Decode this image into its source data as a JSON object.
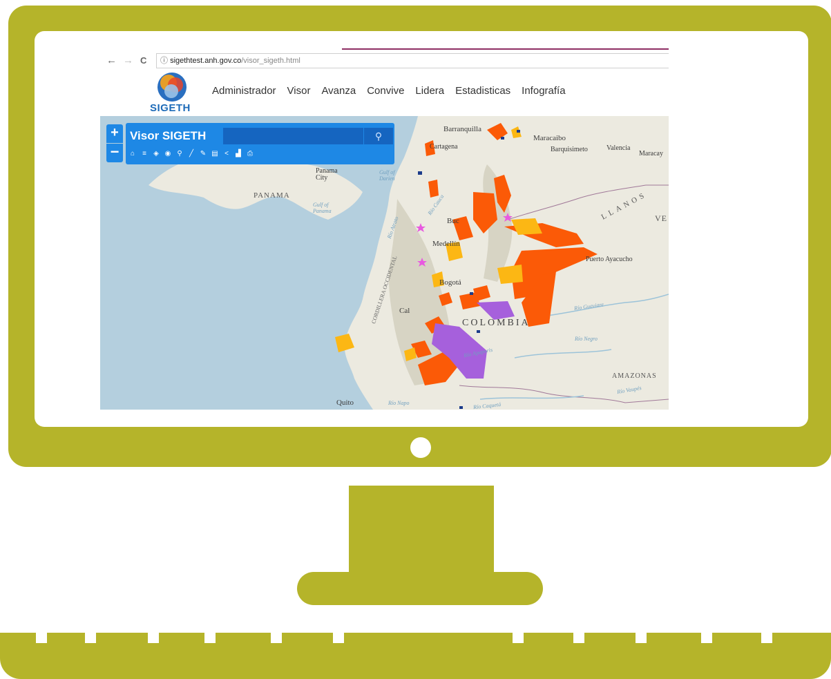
{
  "browser": {
    "back_glyph": "←",
    "forward_glyph": "→",
    "reload_glyph": "C",
    "info_glyph": "ⓘ",
    "url_host": "sigethtest.anh.gov.co",
    "url_path": "/visor_sigeth.html"
  },
  "site": {
    "logo_text": "SIGETH",
    "nav": [
      "Administrador",
      "Visor",
      "Avanza",
      "Convive",
      "Lidera",
      "Estadisticas",
      "Infografía"
    ]
  },
  "viewer": {
    "zoom_in": "+",
    "zoom_out": "−",
    "title": "Visor SIGETH",
    "search_value": "",
    "search_glyph": "⚲",
    "tools": [
      {
        "icon": "home-icon",
        "glyph": "⌂"
      },
      {
        "icon": "list-icon",
        "glyph": "≡"
      },
      {
        "icon": "layers-icon",
        "glyph": "◈"
      },
      {
        "icon": "basemap-icon",
        "glyph": "◉"
      },
      {
        "icon": "location-icon",
        "glyph": "⚲"
      },
      {
        "icon": "draw-icon",
        "glyph": "╱"
      },
      {
        "icon": "edit-icon",
        "glyph": "✎"
      },
      {
        "icon": "comment-icon",
        "glyph": "▤"
      },
      {
        "icon": "share-icon",
        "glyph": "<"
      },
      {
        "icon": "bookmark-icon",
        "glyph": "▟"
      },
      {
        "icon": "print-icon",
        "glyph": "⎙"
      }
    ]
  },
  "map": {
    "labels": {
      "barranquilla": "Barranquilla",
      "maracaibo": "Maracaibo",
      "barquisimeto": "Barquisimeto",
      "valencia": "Valencia",
      "maracay": "Maracay",
      "cartagena": "Cartagena",
      "panama_city": "Panama City",
      "gulf_darien": "Gulf of Darien",
      "panama": "PANAMA",
      "gulf_panama": "Gulf of Panama",
      "llanos": "LLANOS",
      "venezuela_partial": "VE",
      "bucaramanga_partial": "Buc",
      "medellin": "Medellín",
      "puerto_ayacucho": "Puerto Ayacucho",
      "bogota": "Bogotá",
      "cali_partial": "Cal",
      "colombia": "COLOMBIA",
      "rio_guaviare": "Río Guaviare",
      "rio_negro": "Río Negro",
      "rio_apaporis": "Río Apaporis",
      "amazonas": "AMAZONAS",
      "rio_vaupes": "Río Vaupés",
      "quito": "Quito",
      "rio_napo": "Río Napo",
      "rio_caqueta": "Río Caquetá",
      "cordillera": "CORDILLERA OCCIDENTAL",
      "rio_cauca": "Río Cauca",
      "rio_atrato": "Río Atrato"
    },
    "colors": {
      "sea": "#b4cfde",
      "land": "#eceae0",
      "relief": "#d7d4c4",
      "high_priority": "#fb5a07",
      "medium_priority": "#fcb714",
      "special_area": "#a660dc",
      "marker": "#e85ae0",
      "point": "#1b3b8a"
    }
  },
  "theme": {
    "monitor_color": "#b5b42a",
    "accent_blue": "#1e88e5",
    "dark_blue": "#1565c0"
  }
}
